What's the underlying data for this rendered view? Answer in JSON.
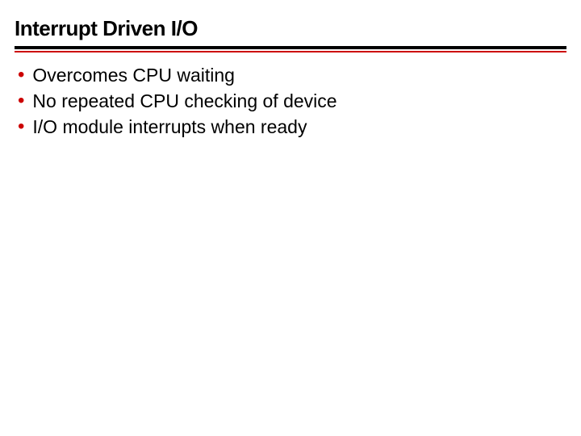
{
  "slide": {
    "title": "Interrupt Driven I/O",
    "bullets": [
      "Overcomes CPU waiting",
      "No repeated CPU checking of device",
      "I/O module interrupts when ready"
    ]
  },
  "colors": {
    "accent": "#cc0000",
    "text": "#000000"
  }
}
